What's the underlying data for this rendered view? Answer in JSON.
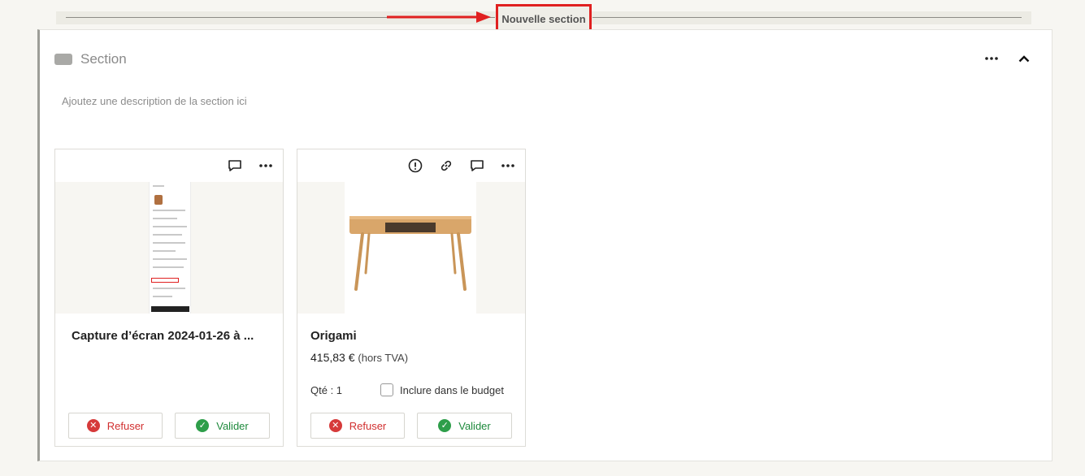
{
  "topbar": {
    "new_section_label": "Nouvelle section"
  },
  "section": {
    "title": "Section",
    "description_placeholder": "Ajoutez une description de la section ici",
    "more_icon": "more-horizontal-icon",
    "collapse_icon": "chevron-up-icon"
  },
  "cards": [
    {
      "title": "Capture d’écran 2024-01-26 à ...",
      "toolbar_icons": [
        "comment-icon",
        "more-horizontal-icon"
      ],
      "refuse_label": "Refuser",
      "validate_label": "Valider"
    },
    {
      "title": "Origami",
      "price": "415,83 €",
      "price_note": "(hors TVA)",
      "qty_label": "Qté : 1",
      "budget_label": "Inclure dans le budget",
      "budget_checked": false,
      "toolbar_icons": [
        "info-icon",
        "link-icon",
        "comment-icon",
        "more-horizontal-icon"
      ],
      "refuse_label": "Refuser",
      "validate_label": "Valider"
    }
  ],
  "colors": {
    "refuse": "#d12f2f",
    "validate": "#1e8a3c",
    "highlight": "#e02020"
  }
}
